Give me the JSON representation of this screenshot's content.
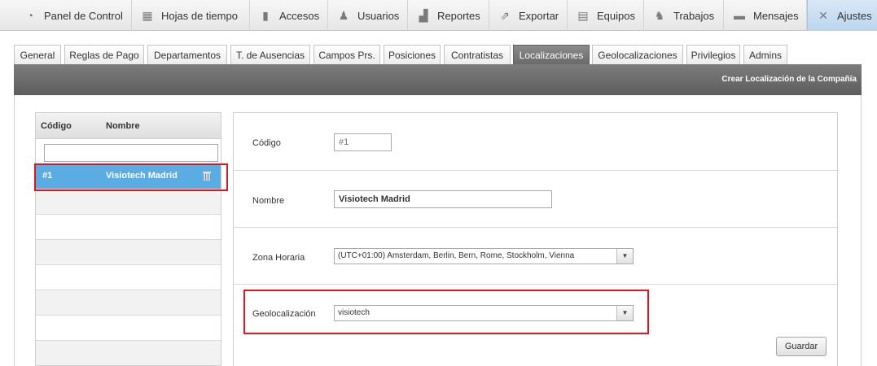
{
  "nav": [
    {
      "label": "Panel de Control",
      "icon": "dashboard-icon",
      "glyph": "◔"
    },
    {
      "label": "Hojas de tiempo",
      "icon": "calendar-icon",
      "glyph": "▦"
    },
    {
      "label": "Accesos",
      "icon": "door-icon",
      "glyph": "▮"
    },
    {
      "label": "Usuarios",
      "icon": "user-icon",
      "glyph": "♟"
    },
    {
      "label": "Reportes",
      "icon": "bar-chart-icon",
      "glyph": "▟"
    },
    {
      "label": "Exportar",
      "icon": "export-icon",
      "glyph": "⇗"
    },
    {
      "label": "Equipos",
      "icon": "device-icon",
      "glyph": "▤"
    },
    {
      "label": "Trabajos",
      "icon": "workers-icon",
      "glyph": "♞"
    },
    {
      "label": "Mensajes",
      "icon": "message-icon",
      "glyph": "▬"
    },
    {
      "label": "Ajustes",
      "icon": "tools-icon",
      "glyph": "✕"
    }
  ],
  "tabs": [
    "General",
    "Reglas de Pago",
    "Departamentos",
    "T. de Ausencias",
    "Campos Prs.",
    "Posiciones",
    "Contratistas",
    "Localizaciones",
    "Geolocalizaciones",
    "Privilegios",
    "Admins"
  ],
  "active_tab": "Localizaciones",
  "toolbar": {
    "create_label": "Crear Localización de la Compañía"
  },
  "list": {
    "col_code": "Código",
    "col_name": "Nombre",
    "filter_value": "",
    "rows": [
      {
        "code": "#1",
        "name": "Visiotech Madrid"
      }
    ]
  },
  "form": {
    "code_label": "Código",
    "code_placeholder": "#1",
    "name_label": "Nombre",
    "name_value": "Visiotech Madrid",
    "tz_label": "Zona Horaria",
    "tz_value": "(UTC+01:00) Amsterdam, Berlin, Bern, Rome, Stockholm, Vienna",
    "geo_label": "Geolocalización",
    "geo_value": "visiotech",
    "save_label": "Guardar"
  },
  "colors": {
    "selected_row": "#5aace3",
    "highlight": "#e0141d",
    "dark_bar": "#666666"
  }
}
